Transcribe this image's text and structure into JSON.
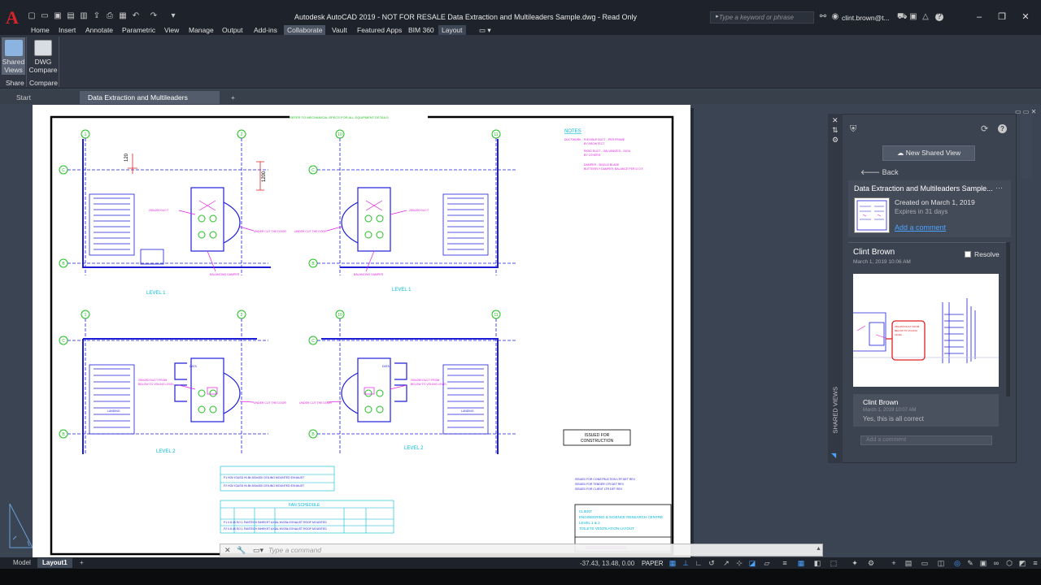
{
  "app": {
    "logo": "A",
    "window_title": "Autodesk AutoCAD 2019 - NOT FOR RESALE    Data Extraction and Multileaders Sample.dwg - Read Only",
    "search_placeholder": "Type a keyword or phrase",
    "user": "clint.brown@t...",
    "minimize": "–",
    "restore": "❐",
    "close": "✕"
  },
  "menu_tabs": [
    "Home",
    "Insert",
    "Annotate",
    "Parametric",
    "View",
    "Manage",
    "Output",
    "Add-ins",
    "Collaborate",
    "Vault",
    "Featured Apps",
    "BIM 360",
    "Layout"
  ],
  "active_menu_tab": "Collaborate",
  "ribbon": {
    "shared_views_label": "Shared\nViews",
    "shared_views_l1": "Shared",
    "shared_views_l2": "Views",
    "dwg_compare_l1": "DWG",
    "dwg_compare_l2": "Compare",
    "panel_share": "Share",
    "panel_compare": "Compare"
  },
  "file_tabs": {
    "start": "Start",
    "doc": "Data Extraction and Multileaders Sample",
    "add": "+"
  },
  "drawing": {
    "top_note": "REFER TO MECHANICAL SPECS FOR ALL EQUIPMENT DETAILS",
    "notes_title": "NOTES",
    "notes_lines": [
      "DUCTWORK - FLEXIBLE DUCT - PER FRAME",
      "BY ARCHITECT",
      "RIGID DUCT - GALVANIZED - 24GA",
      "BY OTHERS",
      "DAMPER - SINGLE BLADE",
      "BUTTERFLY DAMPER, BALANCE PER D.O.F."
    ],
    "levels": [
      "LEVEL 1",
      "LEVEL 1",
      "LEVEL 2",
      "LEVEL 2"
    ],
    "issued": "ISSUED FOR\nCONSTRUCTION",
    "issued_l1": "ISSUED FOR",
    "issued_l2": "CONSTRUCTION",
    "fan_schedule": "FAN SCHEDULE",
    "grid_labels": [
      "1",
      "2",
      "10",
      "11"
    ],
    "row_labels": [
      "C",
      "B"
    ],
    "dim_1": "120",
    "dim_2": "1200",
    "client_title": "CLIENT\nENGINEERING & SCIENCE RESEARCH CENTRE\nLEVEL 1 & 2\nTOILETS VENTILATION LAYOUT",
    "client_l1": "CLIENT",
    "client_l2": "ENGINEERING & SCIENCE RESEARCH CENTRE",
    "client_l3": "LEVEL 1 & 2",
    "client_l4": "TOILETS VENTILATION LAYOUT",
    "undercut_label": "UNDER CUT THE DOOR",
    "data_label": "DATA",
    "landing_label": "LANDING"
  },
  "command_line": {
    "placeholder": "Type a command"
  },
  "status_bar": {
    "model_tab": "Model",
    "layout_tab": "Layout1",
    "add_tab": "+",
    "coords": "-37.43, 13.48, 0.00",
    "space": "PAPER"
  },
  "shared_views": {
    "vertical_title": "SHARED VIEWS",
    "new_button": "New Shared View",
    "back": "Back",
    "view_title": "Data Extraction and Multileaders Sample...",
    "more": "···",
    "created": "Created on March 1, 2019",
    "expires": "Expires in 31 days",
    "add_comment": "Add a comment",
    "comment_author": "Clint Brown",
    "comment_date": "March 1, 2019 10:06 AM",
    "resolve": "Resolve",
    "reply_author": "Clint Brown",
    "reply_date": "March 1, 2019 10:07 AM",
    "reply_text": "Yes, this is all correct",
    "reply_placeholder": "Add a comment"
  },
  "colors": {
    "title_bg": "#1e232b",
    "ribbon_bg": "#2f3541",
    "workspace": "#3b4453",
    "link": "#4aa3ff",
    "drawing_blue": "#1e1ed8",
    "drawing_cyan": "#00b8d8",
    "drawing_magenta": "#e020e0",
    "drawing_green": "#20c020"
  }
}
